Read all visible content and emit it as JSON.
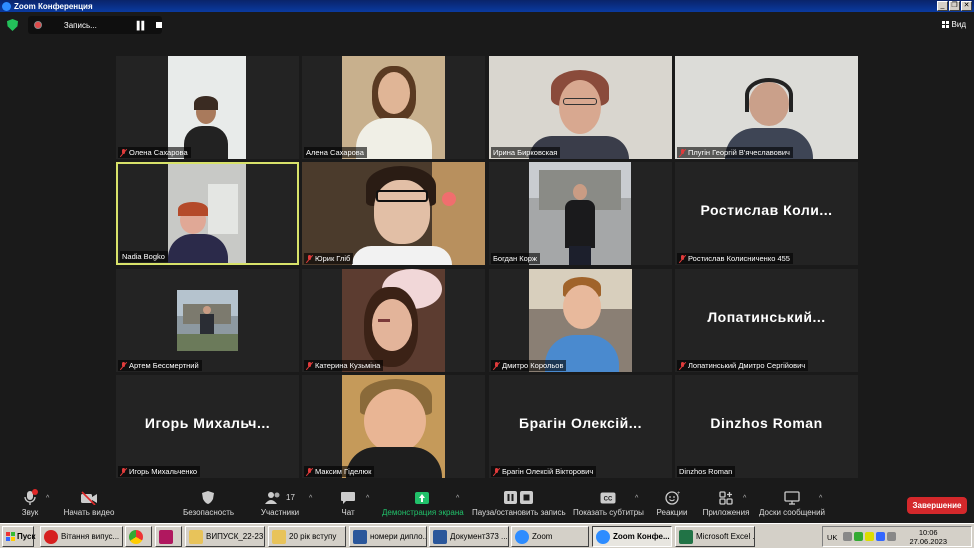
{
  "window": {
    "title": "Zoom Конференция",
    "buttons": [
      "_",
      "❐",
      "✕"
    ]
  },
  "recording": {
    "label": "Запись..."
  },
  "view": {
    "label": "Вид"
  },
  "participants": [
    {
      "name": "Олена Сахарова",
      "muted": true,
      "video": true
    },
    {
      "name": "Алена Сахарова",
      "muted": false,
      "video": true
    },
    {
      "name": "Ирина Бирковская",
      "muted": false,
      "video": true
    },
    {
      "name": "Плугін Георгій В'ячеславович",
      "muted": true,
      "video": true
    },
    {
      "name": "Nadia Bogko",
      "muted": false,
      "video": true,
      "active": true
    },
    {
      "name": "Юрик Гліб",
      "muted": true,
      "video": true
    },
    {
      "name": "Богдан Корж",
      "muted": false,
      "video": true
    },
    {
      "name": "Ростислав Колисниченко 455",
      "muted": true,
      "video": false,
      "display": "Ростислав Коли..."
    },
    {
      "name": "Артем Бессмертний",
      "muted": true,
      "video": true
    },
    {
      "name": "Катерина Кузьміна",
      "muted": true,
      "video": true
    },
    {
      "name": "Дмитро Корольов",
      "muted": true,
      "video": true
    },
    {
      "name": "Лопатинський Дмитро Сергійович",
      "muted": true,
      "video": false,
      "display": "Лопатинський..."
    },
    {
      "name": "Игорь Михальченко",
      "muted": true,
      "video": false,
      "display": "Игорь Михальч..."
    },
    {
      "name": "Максим Гіделюк",
      "muted": true,
      "video": true
    },
    {
      "name": "Брагін Олексій Вікторович",
      "muted": true,
      "video": false,
      "display": "Брагін Олексій..."
    },
    {
      "name": "Dinzhos Roman",
      "muted": false,
      "video": false,
      "display": "Dinzhos Roman"
    }
  ],
  "toolbar": {
    "audio": "Звук",
    "video": "Начать видео",
    "security": "Безопасность",
    "participants": "Участники",
    "participants_count": "17",
    "chat": "Чат",
    "share": "Демонстрация экрана",
    "record": "Пауза/остановить запись",
    "captions": "Показать субтитры",
    "reactions": "Реакции",
    "apps": "Приложения",
    "whiteboards": "Доски сообщений",
    "end": "Завершение"
  },
  "taskbar": {
    "start": "Пуск",
    "tasks": [
      {
        "label": "Вітання випус...",
        "color": "#d62020"
      },
      {
        "label": "",
        "color": "#e8a317"
      },
      {
        "label": "",
        "color": "#b0185f"
      },
      {
        "label": "ВИПУСК_22-23",
        "color": "#e8c35a"
      },
      {
        "label": "20 рік вступу",
        "color": "#e8c35a"
      },
      {
        "label": "номери дипло...",
        "color": "#2b579a"
      },
      {
        "label": "Документ373 ...",
        "color": "#2b579a"
      },
      {
        "label": "Zoom",
        "color": "#2d8cff"
      },
      {
        "label": "Zoom Конфе...",
        "color": "#2d8cff",
        "pressed": true
      },
      {
        "label": "Microsoft Excel ...",
        "color": "#217346"
      }
    ],
    "lang": "UK",
    "time": "10:06",
    "date": "27.06.2023"
  }
}
